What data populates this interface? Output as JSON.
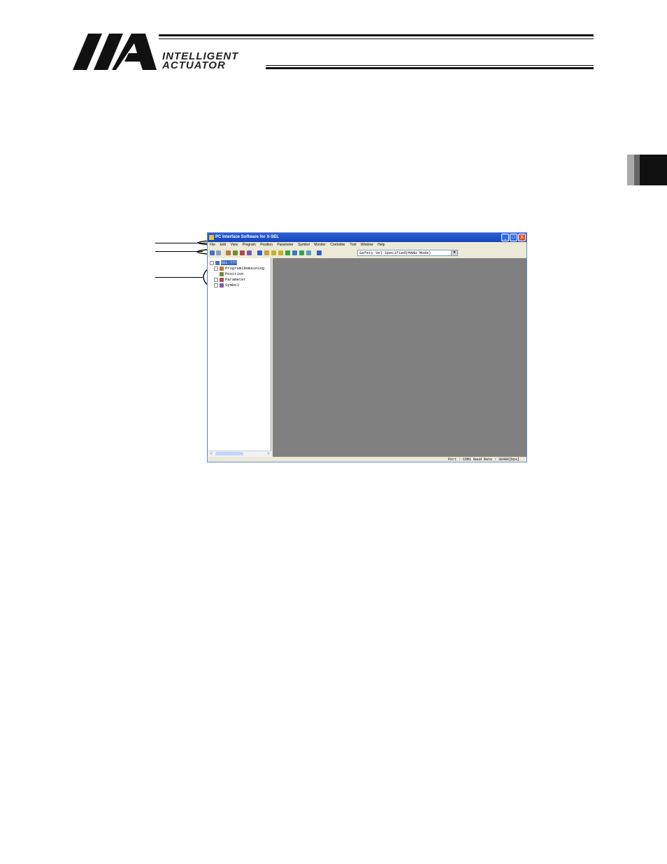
{
  "header": {
    "logo_line1": "INTELLIGENT",
    "logo_line2": "ACTUATOR"
  },
  "app": {
    "title": "PC Interface Software for X-SEL",
    "window_buttons": [
      "_",
      "□",
      "X"
    ],
    "menu": [
      "File",
      "Edit",
      "View",
      "Program",
      "Position",
      "Parameter",
      "Symbol",
      "Monitor",
      "Controller",
      "Tool",
      "Window",
      "Help"
    ],
    "toolbar": {
      "mode_select_value": "Safety Vel Specified(MANU Mode)",
      "mode_select_arrow": "▼"
    },
    "tree": {
      "items": [
        {
          "label": "SEL-???",
          "expander": true,
          "selected": true
        },
        {
          "label": "Program(Remaining",
          "expander": true,
          "selected": false
        },
        {
          "label": "Position",
          "expander": false,
          "selected": false
        },
        {
          "label": "Parameter",
          "expander": true,
          "selected": false
        },
        {
          "label": "Symbol",
          "expander": true,
          "selected": false
        }
      ]
    },
    "scroll": {
      "left": "<",
      "right": ">"
    },
    "status": "Port : COM1  Baud Rate : 38400[bps]"
  },
  "colors": {
    "titlebar": "#1f52c8",
    "workspace": "#808080",
    "window_face": "#ece9d8",
    "selection": "#316ac5"
  }
}
